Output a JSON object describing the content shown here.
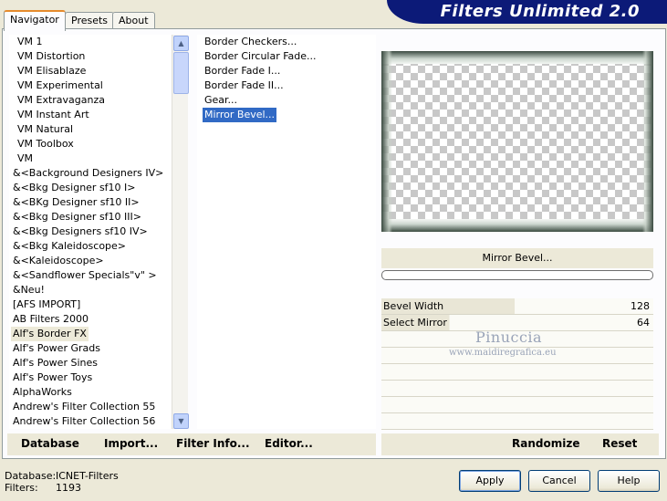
{
  "tabs": [
    {
      "label": "Navigator",
      "active": true
    },
    {
      "label": "Presets",
      "active": false
    },
    {
      "label": "About",
      "active": false
    }
  ],
  "banner": {
    "title": "Filters Unlimited 2.0"
  },
  "categories": [
    "VM 1",
    "VM Distortion",
    "VM Elisablaze",
    "VM Experimental",
    "VM Extravaganza",
    "VM Instant Art",
    "VM Natural",
    "VM Toolbox",
    "VM",
    "&<Background Designers IV>",
    "&<Bkg Designer sf10 I>",
    "&<BKg Designer sf10 II>",
    "&<Bkg Designer sf10 III>",
    "&<Bkg Designers sf10 IV>",
    "&<Bkg Kaleidoscope>",
    "&<Kaleidoscope>",
    "&<Sandflower Specials\"v\" >",
    "&Neu!",
    "[AFS IMPORT]",
    "AB Filters 2000",
    "Alf's Border FX",
    "Alf's Power Grads",
    "Alf's Power Sines",
    "Alf's Power Toys",
    "AlphaWorks",
    "Andrew's Filter Collection 55",
    "Andrew's Filter Collection 56"
  ],
  "selected_category": "Alf's Border FX",
  "filters": [
    "Border Checkers...",
    "Border Circular Fade...",
    "Border Fade I...",
    "Border Fade II...",
    "Gear...",
    "Mirror Bevel..."
  ],
  "selected_filter": "Mirror Bevel...",
  "preview": {
    "filter_name": "Mirror Bevel..."
  },
  "params": [
    {
      "label": "Bevel Width",
      "value": "128",
      "fraction": 0.5
    },
    {
      "label": "Select Mirror",
      "value": "64",
      "fraction": 0.25
    }
  ],
  "watermark": {
    "name": "Pinuccia",
    "site": "www.maidiregrafica.eu"
  },
  "left_actions": {
    "database": "Database",
    "import": "Import...",
    "filter_info": "Filter Info...",
    "editor": "Editor..."
  },
  "right_actions": {
    "randomize": "Randomize",
    "reset": "Reset"
  },
  "footer": {
    "database_label": "Database:",
    "database_value": "ICNET-Filters",
    "filters_label": "Filters:",
    "filters_value": "1193"
  },
  "buttons": {
    "apply": "Apply",
    "cancel": "Cancel",
    "help": "Help"
  },
  "colors": {
    "banner": "#0c1a78",
    "selection": "#316ac5",
    "tab_accent": "#e68b2c"
  }
}
